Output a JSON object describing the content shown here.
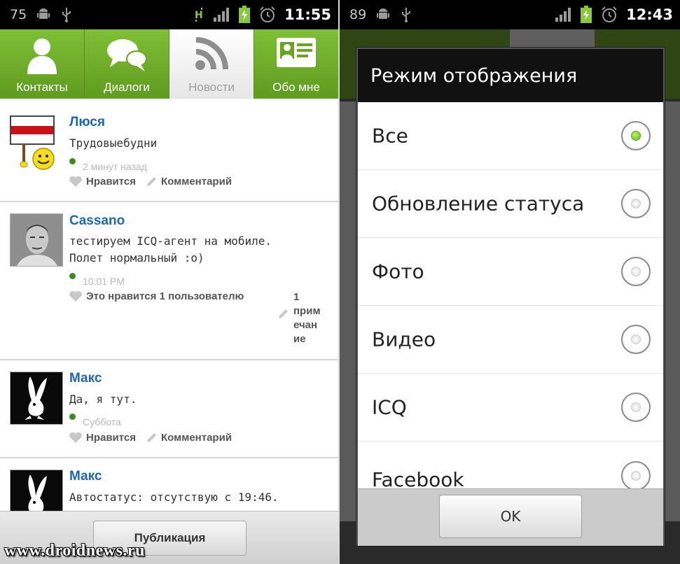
{
  "colors": {
    "tab_green": "#6aa224",
    "author_blue": "#1f66b0",
    "radio_checked": "#6abf1d"
  },
  "left": {
    "status_bar": {
      "battery_level": "75",
      "time": "11:55",
      "icons": [
        "android-icon",
        "usb-icon",
        "h-signal-icon",
        "signal-bars-icon",
        "battery-charging-icon",
        "alarm-icon"
      ]
    },
    "tabs": [
      {
        "label": "Контакты",
        "icon": "contact-icon",
        "active": false
      },
      {
        "label": "Диалоги",
        "icon": "chat-bubbles-icon",
        "active": false
      },
      {
        "label": "Новости",
        "icon": "rss-icon",
        "active": true
      },
      {
        "label": "Обо мне",
        "icon": "id-card-icon",
        "active": false
      }
    ],
    "posts": [
      {
        "author": "Люся",
        "text": "Трудовыебудни",
        "time": "2 минут назад",
        "like": "Нравится",
        "comment": "Комментарий"
      },
      {
        "author": "Cassano",
        "text_line1": "тестируем ICQ-агент на мобиле.",
        "text_line2": "Полет нормальный :о)",
        "time": "10:01 PM",
        "like": "Это нравится 1 пользователю",
        "comment_l1": "1",
        "comment_l2": "прим",
        "comment_l3": "ечан",
        "comment_l4": "ие"
      },
      {
        "author": "Макс",
        "text": "Да, я тут.",
        "time": "Суббота",
        "like": "Нравится",
        "comment": "Комментарий"
      },
      {
        "author": "Макс",
        "text": "Автостатус: отсутствую с 19:46."
      }
    ],
    "publish_button": "Публикация",
    "watermark": "www.droidnews.ru"
  },
  "right": {
    "status_bar": {
      "battery_level": "89",
      "time": "12:43"
    },
    "dialog": {
      "title": "Режим отображения",
      "options": [
        {
          "label": "Все",
          "checked": true
        },
        {
          "label": "Обновление статуса",
          "checked": false
        },
        {
          "label": "Фото",
          "checked": false
        },
        {
          "label": "Видео",
          "checked": false
        },
        {
          "label": "ICQ",
          "checked": false
        },
        {
          "label": "Facebook",
          "checked": false
        }
      ],
      "ok_button": "OK"
    }
  }
}
